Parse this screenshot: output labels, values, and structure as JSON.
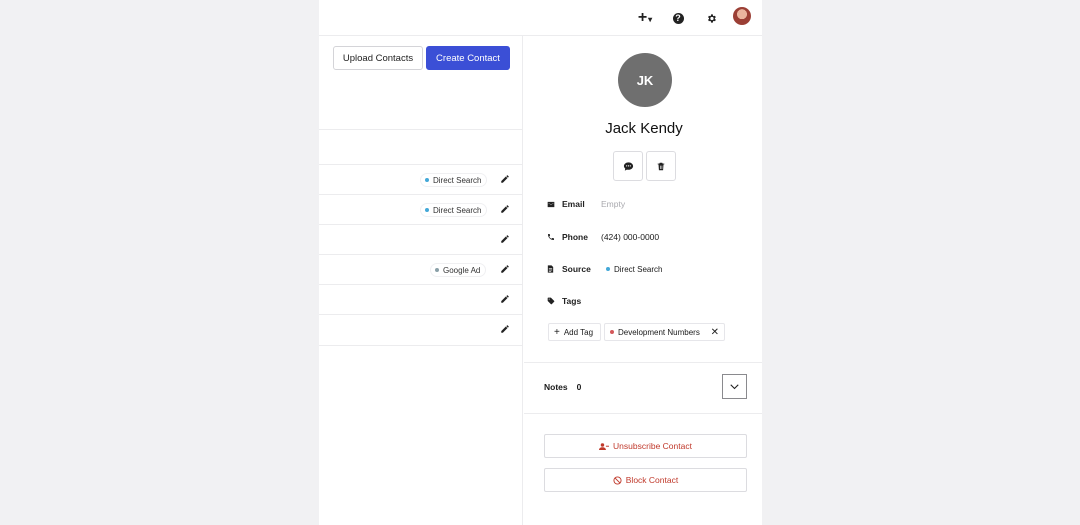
{
  "topbar": {
    "plus_icon": "plus-icon",
    "help_icon": "help-icon",
    "settings_icon": "gear-icon",
    "help_glyph": "?"
  },
  "actions": {
    "upload_label": "Upload Contacts",
    "create_label": "Create Contact",
    "accent_color": "#3b4fd6"
  },
  "rows": [
    {
      "source": "",
      "dot": ""
    },
    {
      "source": "Direct Search",
      "dot": "#43a8d8"
    },
    {
      "source": "Direct Search",
      "dot": "#43a8d8"
    },
    {
      "source": "",
      "dot": ""
    },
    {
      "source": "Google Ad",
      "dot": "#8aa0a8"
    },
    {
      "source": "",
      "dot": ""
    },
    {
      "source": "",
      "dot": ""
    }
  ],
  "contact": {
    "initials": "JK",
    "name": "Jack Kendy",
    "email_label": "Email",
    "email_value": "Empty",
    "phone_label": "Phone",
    "phone_value": "(424) 000-0000",
    "source_label": "Source",
    "source_value": "Direct Search",
    "tags_label": "Tags",
    "add_tag_label": "Add Tag",
    "tags": [
      "Development Numbers"
    ],
    "notes_label": "Notes",
    "notes_count": "0",
    "unsubscribe_label": "Unsubscribe Contact",
    "block_label": "Block Contact",
    "danger_color": "#c0392b"
  }
}
